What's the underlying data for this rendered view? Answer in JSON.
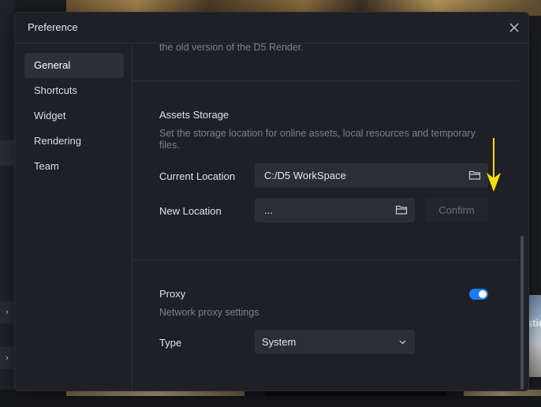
{
  "dialog": {
    "title": "Preference",
    "close_icon": "close-icon"
  },
  "sidebar": {
    "items": [
      {
        "label": "General",
        "active": true
      },
      {
        "label": "Shortcuts"
      },
      {
        "label": "Widget"
      },
      {
        "label": "Rendering"
      },
      {
        "label": "Team"
      }
    ]
  },
  "content": {
    "prev_text": "the old version of the D5 Render.",
    "assets_storage": {
      "heading": "Assets Storage",
      "description_line1": "Set the storage location for online assets, local resources and temporary",
      "description_line2": "files.",
      "current_location_label": "Current Location",
      "current_location_value": "C:/D5 WorkSpace",
      "new_location_label": "New Location",
      "new_location_value": "...",
      "confirm_label": "Confirm",
      "folder_icon": "folder-icon"
    },
    "proxy": {
      "heading": "Proxy",
      "description": "Network proxy settings",
      "enabled": true,
      "type_label": "Type",
      "type_value": "System"
    }
  },
  "background": {
    "right_photo_text": "stic"
  },
  "colors": {
    "accent": "#1e7bef",
    "annotation_arrow": "#f6e200",
    "dialog_bg": "#1f2026"
  }
}
